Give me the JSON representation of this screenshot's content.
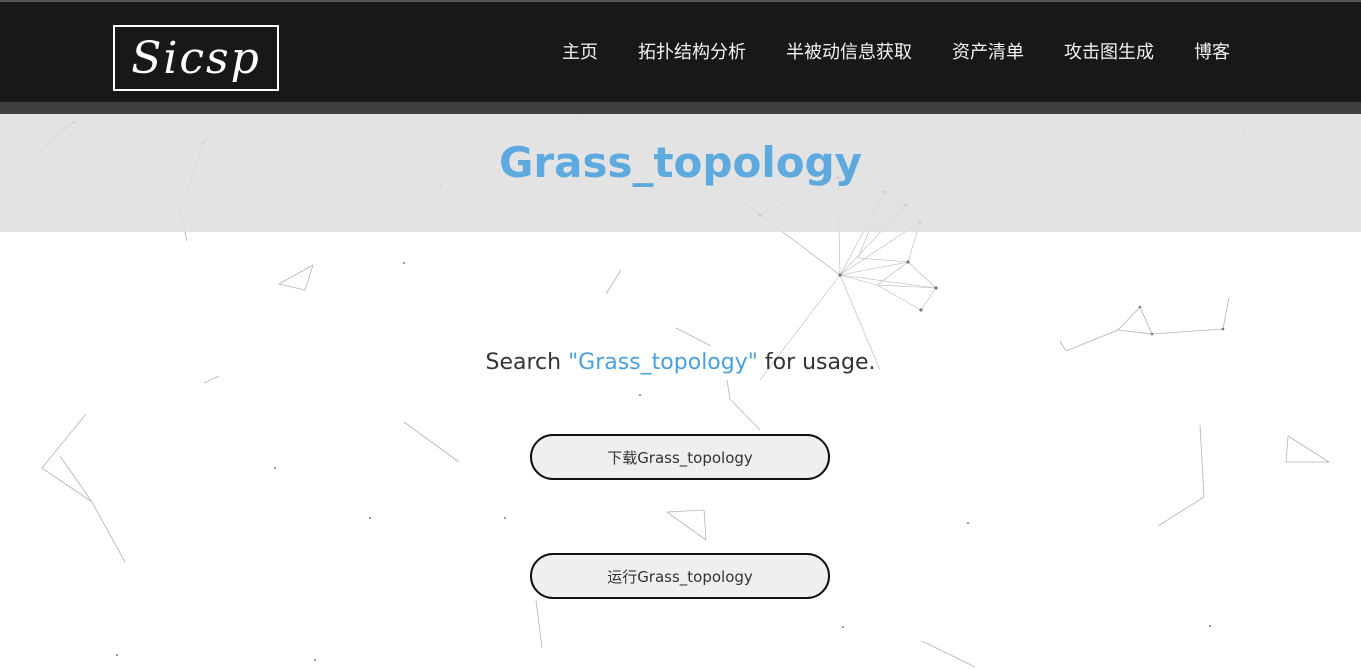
{
  "header": {
    "logo_text": "Sicsp",
    "nav": [
      {
        "label": "主页"
      },
      {
        "label": "拓扑结构分析"
      },
      {
        "label": "半被动信息获取"
      },
      {
        "label": "资产清单"
      },
      {
        "label": "攻击图生成"
      },
      {
        "label": "博客"
      }
    ]
  },
  "main": {
    "title": "Grass_topology",
    "search": {
      "prefix": "Search ",
      "keyword": "\"Grass_topology\"",
      "suffix": " for usage."
    },
    "buttons": {
      "download_label": "下载Grass_topology",
      "run_label": "运行Grass_topology"
    }
  },
  "colors": {
    "header_bg": "#181818",
    "accent": "#5ea9de",
    "title_band": "#e3e3e3",
    "button_bg": "#efefef"
  }
}
